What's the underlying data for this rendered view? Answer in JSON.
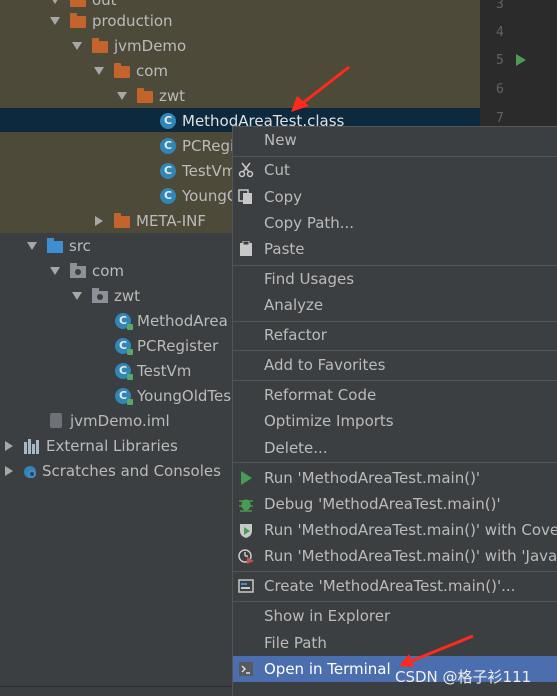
{
  "tree": {
    "top_partial": "out",
    "production": "production",
    "jvmdemo_folder": "jvmDemo",
    "com": "com",
    "zwt": "zwt",
    "out_files": [
      "MethodAreaTest.class",
      "PCRegi",
      "TestVm",
      "YoungO"
    ],
    "meta_inf": "META-INF",
    "src": "src",
    "src_com": "com",
    "src_zwt": "zwt",
    "src_files": [
      "MethodArea",
      "PCRegister",
      "TestVm",
      "YoungOldTes"
    ],
    "iml": "jvmDemo.iml",
    "external": "External Libraries",
    "scratches": "Scratches and Consoles",
    "class_glyph": "C"
  },
  "gutter": {
    "lines": [
      "3",
      "4",
      "5",
      "6",
      "7"
    ]
  },
  "menu": {
    "items": [
      {
        "label": "New"
      },
      {
        "label": "Cut",
        "icon": "scissors-icon"
      },
      {
        "label": "Copy",
        "icon": "copy-icon"
      },
      {
        "label": "Copy Path..."
      },
      {
        "label": "Paste",
        "icon": "paste-icon"
      },
      {
        "label": "Find Usages"
      },
      {
        "label": "Analyze"
      },
      {
        "label": "Refactor"
      },
      {
        "label": "Add to Favorites"
      },
      {
        "label": "Reformat Code"
      },
      {
        "label": "Optimize Imports"
      },
      {
        "label": "Delete..."
      },
      {
        "label": "Run 'MethodAreaTest.main()'",
        "icon": "run-icon"
      },
      {
        "label": "Debug 'MethodAreaTest.main()'",
        "icon": "debug-icon"
      },
      {
        "label": "Run 'MethodAreaTest.main()' with Cover",
        "icon": "coverage-icon"
      },
      {
        "label": "Run 'MethodAreaTest.main()' with 'Java F",
        "icon": "profiler-icon"
      },
      {
        "label": "Create 'MethodAreaTest.main()'...",
        "icon": "run-config-icon"
      },
      {
        "label": "Show in Explorer"
      },
      {
        "label": "File Path"
      },
      {
        "label": "Open in Terminal",
        "icon": "terminal-icon",
        "highlighted": true
      }
    ]
  },
  "watermark": "CSDN @格子衫111",
  "colors": {
    "tree_bg": "#3c3f41",
    "out_folder_bg": "#4e4a39",
    "selected_row": "#0d293e",
    "menu_highlight": "#4b6eaf",
    "annotation_arrow": "#ff2a1a"
  }
}
